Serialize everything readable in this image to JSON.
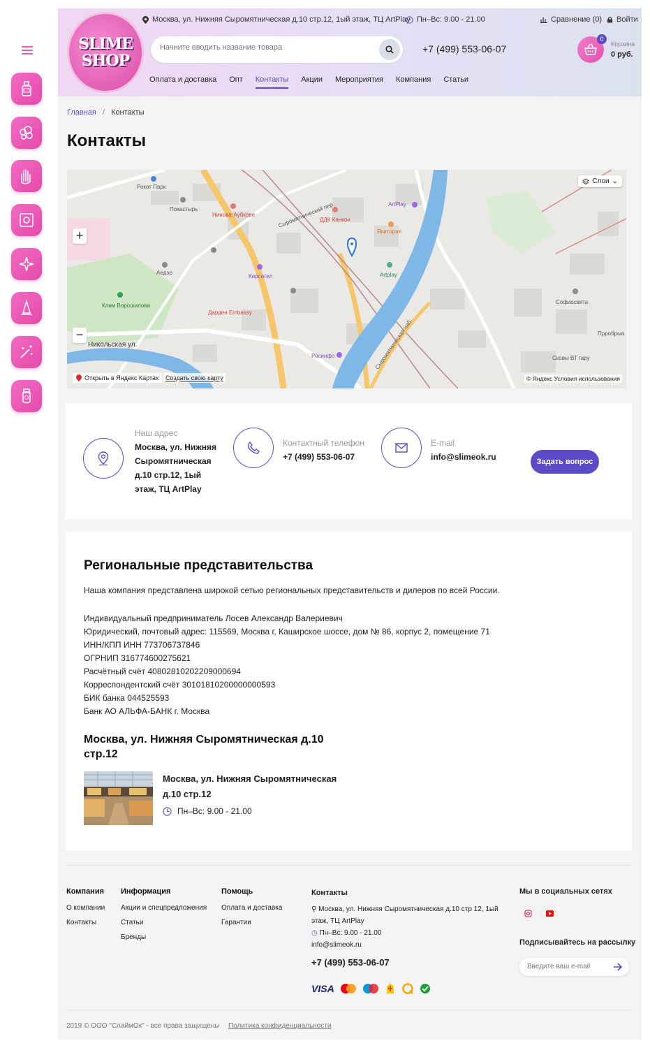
{
  "header": {
    "logo_line1": "SLIME",
    "logo_line2": "SHOP",
    "address": "Москва, ул. Нижняя Сыромятническая д.10 стр.12, 1ый этаж, ТЦ ArtPlay",
    "hours": "Пн–Вс: 9.00 - 21.00",
    "compare": "Сравнение (0)",
    "login": "Войти",
    "search_placeholder": "Начните вводить название товара",
    "phone": "+7 (499) 553-06-07",
    "cart_label": "Корзина",
    "cart_sum": "0 руб.",
    "cart_count": "0",
    "nav": [
      {
        "label": "Оплата и доставка"
      },
      {
        "label": "Опт"
      },
      {
        "label": "Контакты",
        "active": true
      },
      {
        "label": "Акции"
      },
      {
        "label": "Мероприятия"
      },
      {
        "label": "Компания"
      },
      {
        "label": "Статьи"
      }
    ]
  },
  "categories": [
    "bottle",
    "clouds",
    "hands",
    "poster",
    "sparkles",
    "cone",
    "magic",
    "jar"
  ],
  "breadcrumb": {
    "home": "Главная",
    "sep": "/",
    "current": "Контакты"
  },
  "page_title": "Контакты",
  "map": {
    "layers": "Слои",
    "open": "Открыть в Яндекс Картах",
    "create": "Создать свою карту",
    "terms": "© Яндекс Условия использования",
    "zoom_in": "+",
    "zoom_out": "−",
    "labels": [
      "Рокот Парк",
      "Покастырь",
      "Нинова-Аубкове",
      "ДДК Канкон",
      "ArtPlay",
      "Якитория",
      "Artplay",
      "Кирсател",
      "Дарден Embassy",
      "Аедэр",
      "Клим Ворошилова",
      "Никольская ул.",
      "Сыромятнический пер.",
      "Сыромятническая наб.",
      "Росинфо",
      "Софиосвята",
      "Прробрыа",
      "Сковы ВТ гару"
    ]
  },
  "contacts": {
    "address_label": "Наш адрес",
    "address_lines": [
      "Москва, ул. Нижняя",
      "Сыромятническая",
      "д.10 стр.12, 1ый",
      "этаж, ТЦ ArtPlay"
    ],
    "phone_label": "Контактный телефон",
    "phone": "+7 (499) 553-06-07",
    "email_label": "E-mail",
    "email": "info@slimeok.ru",
    "ask_button": "Задать вопрос"
  },
  "regional": {
    "title": "Региональные представительства",
    "intro": "Наша компания представлена широкой сетью региональных представительств и дилеров по всей России.",
    "requisites": [
      "Индивидуальный предприниматель Лосев Александр Валериевич",
      "Юридический, почтовый адрес: 115569, Москва г, Каширское шоссе, дом № 86, корпус 2, помещение 71",
      "ИНН/КПП ИНН 773706737846",
      "ОГРНИП 316774600275621",
      "Расчётный счёт 40802810202209000694",
      "Корреспондентский счёт 30101810200000000593",
      "БИК банка 044525593",
      "Банк АО АЛЬФА-БАНК г. Москва"
    ],
    "office_title_1": "Москва, ул. Нижняя Сыромятническая д.10",
    "office_title_2": "стр.12",
    "store_address_1": "Москва, ул. Нижняя Сыромятническая",
    "store_address_2": "д.10 стр.12",
    "store_hours": "Пн–Вс: 9.00 - 21.00"
  },
  "footer": {
    "company": {
      "title": "Компания",
      "items": [
        "О компании",
        "Контакты"
      ]
    },
    "info": {
      "title": "Информация",
      "items": [
        "Акции и спецпредложения",
        "Статьи",
        "Бренды"
      ]
    },
    "help": {
      "title": "Помощь",
      "items": [
        "Оплата и доставка",
        "Гарантии"
      ]
    },
    "contacts_title": "Контакты",
    "address": "Москва, ул. Нижняя Сыромятническая д.10 стр 12, 1ый этаж, ТЦ ArtPlay",
    "hours": "Пн–Вс: 9.00 - 21.00",
    "email": "info@slimeok.ru",
    "phone": "+7 (499) 553-06-07",
    "social_title": "Мы в социальных сетях",
    "subscribe_title": "Подписывайтесь на рассылку",
    "email_placeholder": "Введите ваш e-mail",
    "copyright": "2019 © ООО \"СлаймОк\" - все права защищены",
    "policy": "Политика конфиденциальности",
    "visa": "VISA"
  },
  "colors": {
    "accent": "#5b4bc7",
    "pink": "#e54aa8"
  }
}
